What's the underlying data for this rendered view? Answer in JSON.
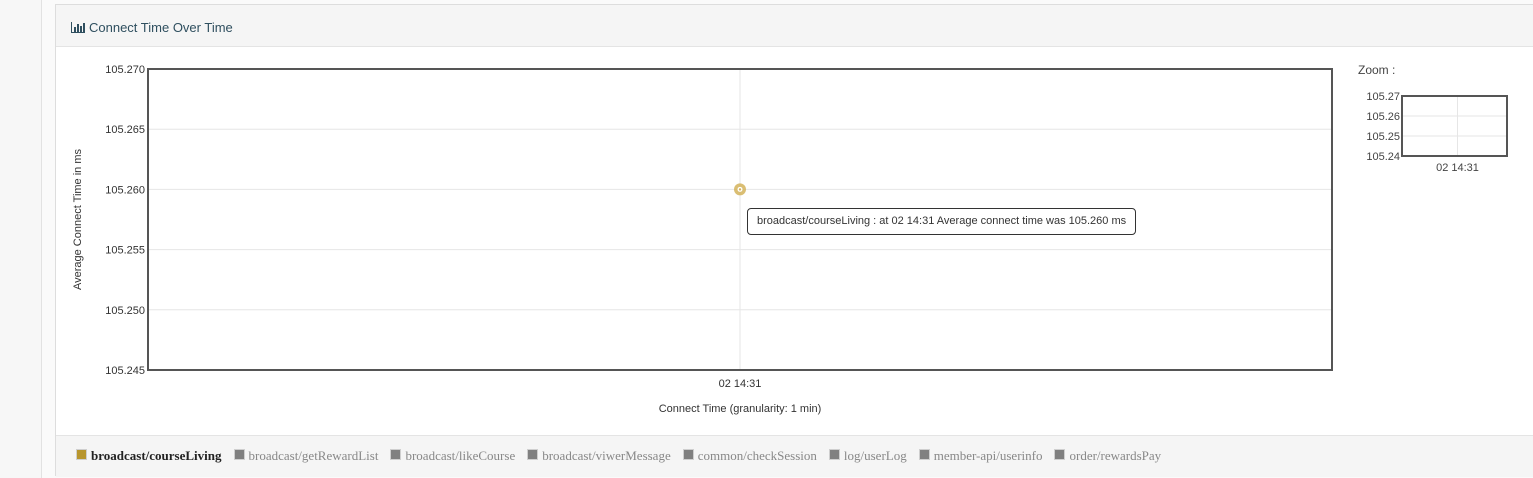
{
  "panel": {
    "title": "Connect Time Over Time",
    "title_icon": "bar-chart-icon"
  },
  "zoom": {
    "label": "Zoom :"
  },
  "tooltip": {
    "text": "broadcast/courseLiving : at 02 14:31 Average connect time was 105.260 ms"
  },
  "legend": {
    "items": [
      {
        "label": "broadcast/courseLiving",
        "active": true,
        "color": "#b8962e"
      },
      {
        "label": "broadcast/getRewardList",
        "active": false,
        "color": "#808080"
      },
      {
        "label": "broadcast/likeCourse",
        "active": false,
        "color": "#808080"
      },
      {
        "label": "broadcast/viwerMessage",
        "active": false,
        "color": "#808080"
      },
      {
        "label": "common/checkSession",
        "active": false,
        "color": "#808080"
      },
      {
        "label": "log/userLog",
        "active": false,
        "color": "#808080"
      },
      {
        "label": "member-api/userinfo",
        "active": false,
        "color": "#808080"
      },
      {
        "label": "order/rewardsPay",
        "active": false,
        "color": "#808080"
      }
    ]
  },
  "chart_data": {
    "type": "line",
    "title": "",
    "xlabel": "Connect Time (granularity: 1 min)",
    "ylabel": "Average Connect Time in ms",
    "x_ticks": [
      "02 14:31"
    ],
    "y_ticks": [
      "105.245",
      "105.250",
      "105.255",
      "105.260",
      "105.265",
      "105.270"
    ],
    "ylim": [
      105.245,
      105.27
    ],
    "grid": true,
    "legend_position": "bottom",
    "series": [
      {
        "name": "broadcast/courseLiving",
        "color": "#d4b35a",
        "x": [
          "02 14:31"
        ],
        "y": [
          105.26
        ]
      }
    ],
    "zoom_overview": {
      "y_ticks": [
        "105.27",
        "105.26",
        "105.25",
        "105.24"
      ],
      "ylim": [
        105.24,
        105.27
      ],
      "x_ticks": [
        "02 14:31"
      ]
    }
  }
}
